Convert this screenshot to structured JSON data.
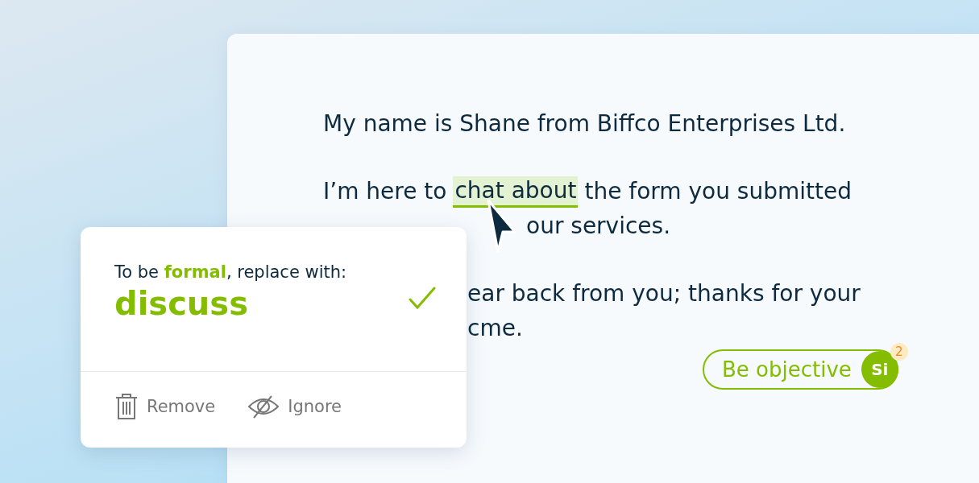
{
  "document": {
    "paragraphs": [
      {
        "lines": [
          {
            "kind": "full",
            "segments": [
              {
                "text": "My name is Shane from Biffco Enterprises Ltd.",
                "kind": "text"
              }
            ]
          }
        ]
      },
      {
        "lines": [
          {
            "kind": "full",
            "segments": [
              {
                "text": "I’m here to",
                "kind": "text"
              },
              {
                "text": "chat about",
                "kind": "highlight"
              },
              {
                "text": "the form you submitted",
                "kind": "text"
              }
            ]
          },
          {
            "kind": "full",
            "segments": [
              {
                "text": "our services.",
                "kind": "after_pointer"
              }
            ]
          }
        ]
      },
      {
        "lines": [
          {
            "kind": "covered",
            "segments": [
              {
                "text": "ear back from you; thanks for your",
                "kind": "text"
              }
            ]
          },
          {
            "kind": "covered",
            "segments": [
              {
                "text": "cme.",
                "kind": "text"
              }
            ]
          }
        ]
      }
    ],
    "suggestion_chip": {
      "label": "Be objective",
      "avatar": "Si",
      "count": "2"
    }
  },
  "popup": {
    "prompt": "To be *formal*, replace with:",
    "replacement": "discuss",
    "actions": [
      {
        "label": "Remove",
        "kind": "remove"
      },
      {
        "label": "Ignore",
        "kind": "ignore"
      }
    ]
  }
}
